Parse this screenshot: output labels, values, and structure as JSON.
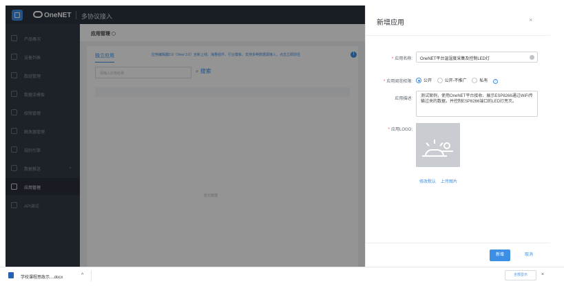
{
  "header": {
    "brand": "OneNET",
    "section": "多协议接入"
  },
  "sidebar": {
    "items": [
      {
        "label": "产品概况",
        "icon": "overview-icon"
      },
      {
        "label": "设备列表",
        "icon": "list-icon"
      },
      {
        "label": "数组管理",
        "icon": "grid-icon"
      },
      {
        "label": "数据流模板",
        "icon": "stream-icon"
      },
      {
        "label": "权限管理",
        "icon": "key-icon"
      },
      {
        "label": "触发器管理",
        "icon": "trigger-icon"
      },
      {
        "label": "规则引擎",
        "icon": "rule-icon"
      },
      {
        "label": "数据推送",
        "icon": "push-icon",
        "has_submenu": true
      },
      {
        "label": "应用管理",
        "icon": "app-icon",
        "active": true
      },
      {
        "label": "API调试",
        "icon": "api-icon"
      }
    ]
  },
  "main": {
    "title": "应用管理",
    "tab": "独立应用",
    "notice": "应用编辑器2.0（View 2.0）全新上线，海量组件、行业模板、支持多种数据源接入，点击立即前往",
    "search_placeholder": "请输入应用名称",
    "search_button": "搜索",
    "empty": "暂无数据"
  },
  "drawer": {
    "title": "新增应用",
    "close": "×",
    "name_label": "应用名称:",
    "name_value": "OneNET平台温湿度采集及控制LED灯",
    "permission_label": "应用阅览权限:",
    "permission_options": [
      "公开",
      "公开-不推广",
      "私有"
    ],
    "permission_selected": "公开",
    "desc_label": "应用描述:",
    "desc_value": "测试案例，使用OneNET平台接收、展示ESP8266通过WiFi传输过来的数据，并控制ESP8266端口的LED灯亮灭。",
    "logo_label": "应用LOGO:",
    "logo_links": [
      "修改默认",
      "上传图片"
    ],
    "add_button": "新增",
    "cancel_button": "取消"
  },
  "download_bar": {
    "file": "学校课程思政示....docx",
    "show_all": "全部显示",
    "close": "×"
  },
  "colors": {
    "primary": "#3d8fe6",
    "sidebar": "#333a45",
    "required": "#e84a4a"
  }
}
